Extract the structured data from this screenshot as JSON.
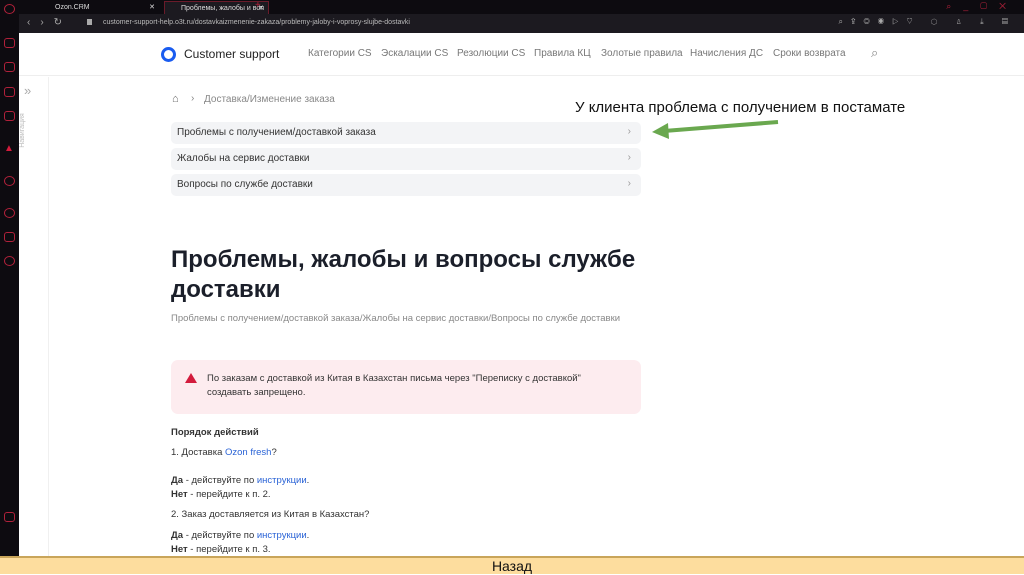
{
  "browser": {
    "tabs": [
      "Ozon.CRM",
      "Проблемы, жалобы и воп"
    ],
    "url": "customer-support-help.o3t.ru/dostavkaizmenenie-zakaza/problemy-jaloby-i-voprosy-slujbe-dostavki"
  },
  "header": {
    "brand": "Customer support",
    "nav": [
      "Категории CS",
      "Эскалации CS",
      "Резолюции CS",
      "Правила КЦ",
      "Золотые правила",
      "Начисления ДС",
      "Сроки возврата"
    ]
  },
  "sidenav_label": "Навигация",
  "breadcrumb": "Доставка/Изменение заказа",
  "rows": [
    "Проблемы с получением/доставкой заказа",
    "Жалобы на сервис доставки",
    "Вопросы по службе доставки"
  ],
  "title": "Проблемы, жалобы и вопросы службе доставки",
  "subtitle": "Проблемы с получением/доставкой заказа/Жалобы на сервис доставки/Вопросы по службе доставки",
  "alert": "По заказам с доставкой из Китая в Казахстан письма через \"Переписку с доставкой\" создавать запрещено.",
  "steps": {
    "heading": "Порядок действий",
    "s1_pre": "1. Доставка ",
    "s1_link": "Ozon fresh",
    "s1_post": "?",
    "yes": "Да",
    "yes_text": " - действуйте по ",
    "yes_link": "инструкции",
    "dot": ".",
    "no": "Нет",
    "no1_text": " - перейдите к п. 2.",
    "s2": "2. Заказ доставляется из Китая в Казахстан?",
    "no2_text": " - перейдите к п. 3."
  },
  "annotation": "У клиента проблема с получением в постамате",
  "footer": "Назад"
}
